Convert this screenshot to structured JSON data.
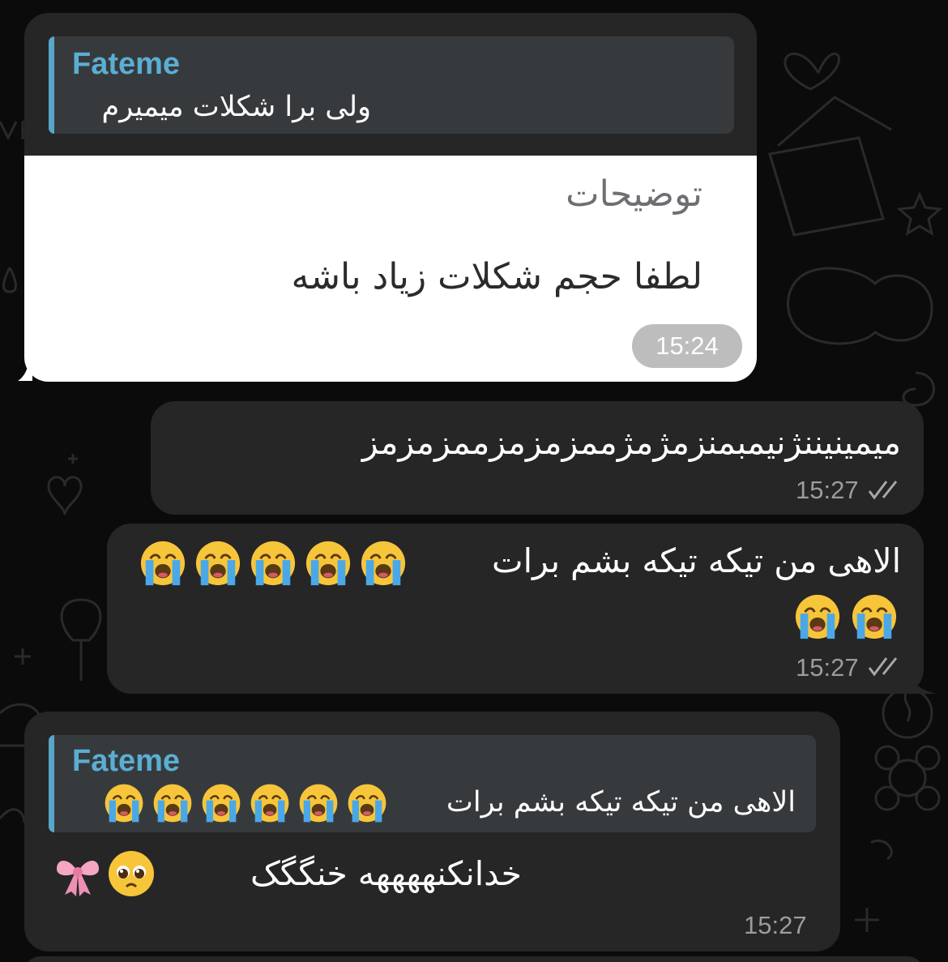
{
  "messages": [
    {
      "direction": "received",
      "reply": {
        "author": "Fateme",
        "text": "ولی برا شکلات میمیرم"
      },
      "image": {
        "heading": "توضیحات",
        "body": "لطفا حجم شکلات زیاد باشه"
      },
      "time": "15:24"
    },
    {
      "direction": "sent",
      "text": "میمینیننژنیمبمنزمژمژممزمزمزممزمزمز",
      "time": "15:27",
      "status_icon": "double-check-icon"
    },
    {
      "direction": "sent",
      "line1": "الاهی من تیکه تیکه بشم برات",
      "emojis_line1": [
        "crying-face-emoji",
        "crying-face-emoji",
        "crying-face-emoji",
        "crying-face-emoji",
        "crying-face-emoji"
      ],
      "emojis_line2": [
        "crying-face-emoji",
        "crying-face-emoji"
      ],
      "time": "15:27",
      "status_icon": "double-check-icon"
    },
    {
      "direction": "received",
      "reply": {
        "author": "Fateme",
        "text": "الاهی من تیکه تیکه بشم برات",
        "emojis": [
          "crying-face-emoji",
          "crying-face-emoji",
          "crying-face-emoji",
          "crying-face-emoji",
          "crying-face-emoji",
          "crying-face-emoji"
        ]
      },
      "text": "خدانکنههههه خنگگک",
      "emojis": [
        "ribbon-emoji",
        "pleading-face-emoji"
      ],
      "time": "15:27"
    }
  ],
  "colors": {
    "background": "#0b0b0b",
    "bubble": "#262626",
    "reply_box": "#373a3d",
    "reply_accent": "#58a6c8",
    "reply_name": "#5aaed3",
    "time": "#9c9c9c"
  }
}
